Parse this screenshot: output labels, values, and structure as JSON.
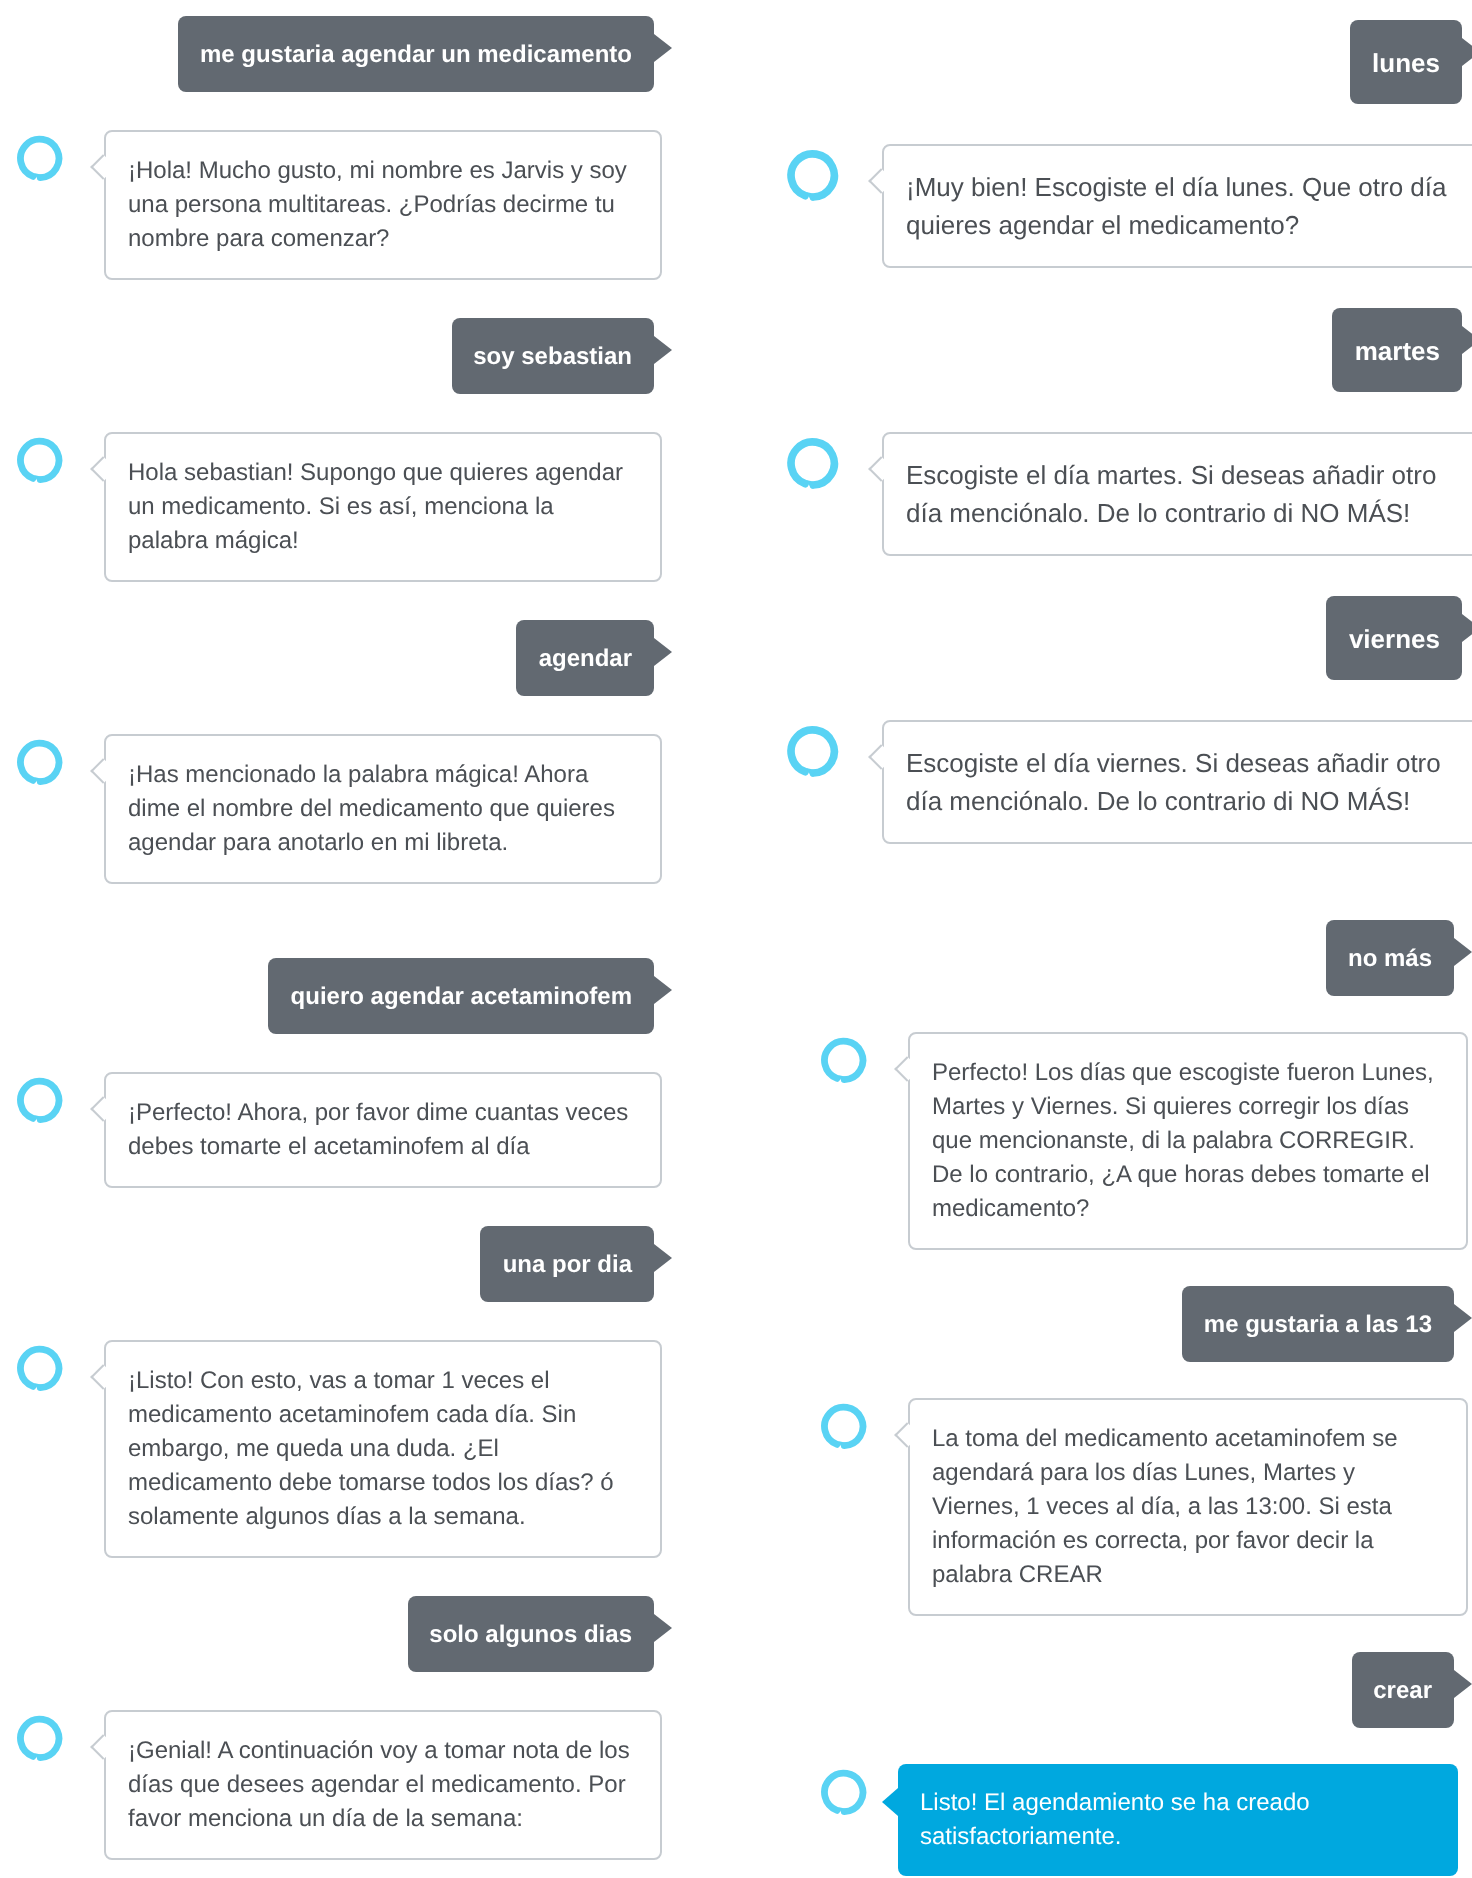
{
  "panels": [
    {
      "messages": [
        {
          "kind": "user",
          "text": "me gustaria agendar un medicamento"
        },
        {
          "kind": "bot",
          "text": "¡Hola! Mucho gusto, mi nombre es Jarvis y soy una persona multitareas. ¿Podrías decirme tu nombre para comenzar?"
        },
        {
          "kind": "user",
          "text": "soy sebastian"
        },
        {
          "kind": "bot",
          "text": "Hola sebastian! Supongo que quieres agendar un medicamento. Si es así, menciona la palabra mágica!"
        },
        {
          "kind": "user",
          "text": "agendar"
        },
        {
          "kind": "bot",
          "text": "¡Has mencionado la palabra mágica! Ahora dime el nombre del medicamento que quieres agendar para anotarlo en mi libreta."
        }
      ]
    },
    {
      "messages": [
        {
          "kind": "user",
          "text": "quiero agendar acetaminofem"
        },
        {
          "kind": "bot",
          "text": "¡Perfecto! Ahora, por favor dime cuantas veces debes tomarte el acetaminofem al día"
        },
        {
          "kind": "user",
          "text": "una por dia"
        },
        {
          "kind": "bot",
          "text": "¡Listo! Con esto, vas a tomar 1 veces el medicamento acetaminofem cada día. Sin embargo, me queda una duda. ¿El medicamento debe tomarse todos los días? ó solamente algunos días a la semana."
        },
        {
          "kind": "user",
          "text": "solo algunos dias"
        },
        {
          "kind": "bot",
          "text": "¡Genial! A continuación voy a tomar nota de los días que desees agendar el medicamento. Por favor menciona un día de la semana:"
        }
      ]
    },
    {
      "messages": [
        {
          "kind": "user",
          "text": "lunes"
        },
        {
          "kind": "bot",
          "text": "¡Muy bien! Escogiste el día lunes. Que otro día quieres agendar el medicamento?"
        },
        {
          "kind": "user",
          "text": "martes"
        },
        {
          "kind": "bot",
          "text": "Escogiste el día martes. Si deseas añadir otro día menciónalo. De lo contrario di NO MÁS!"
        },
        {
          "kind": "user",
          "text": "viernes"
        },
        {
          "kind": "bot",
          "text": "Escogiste el día viernes. Si deseas añadir otro día menciónalo. De lo contrario di NO MÁS!"
        }
      ]
    },
    {
      "messages": [
        {
          "kind": "user",
          "text": "no más"
        },
        {
          "kind": "bot",
          "text": "Perfecto! Los días que escogiste fueron Lunes, Martes y Viernes. Si quieres corregir los días que mencionanste, di la palabra CORREGIR. De lo contrario, ¿A que horas debes tomarte el medicamento?"
        },
        {
          "kind": "user",
          "text": "me gustaria a las 13"
        },
        {
          "kind": "bot",
          "text": "La toma del medicamento acetaminofem se agendará para los días Lunes, Martes y Viernes, 1 veces al día, a las 13:00. Si esta información es correcta, por favor decir la palabra CREAR"
        },
        {
          "kind": "user",
          "text": "crear"
        },
        {
          "kind": "bot_highlight",
          "text": "Listo! El agendamiento se ha creado satisfactoriamente."
        }
      ]
    }
  ]
}
